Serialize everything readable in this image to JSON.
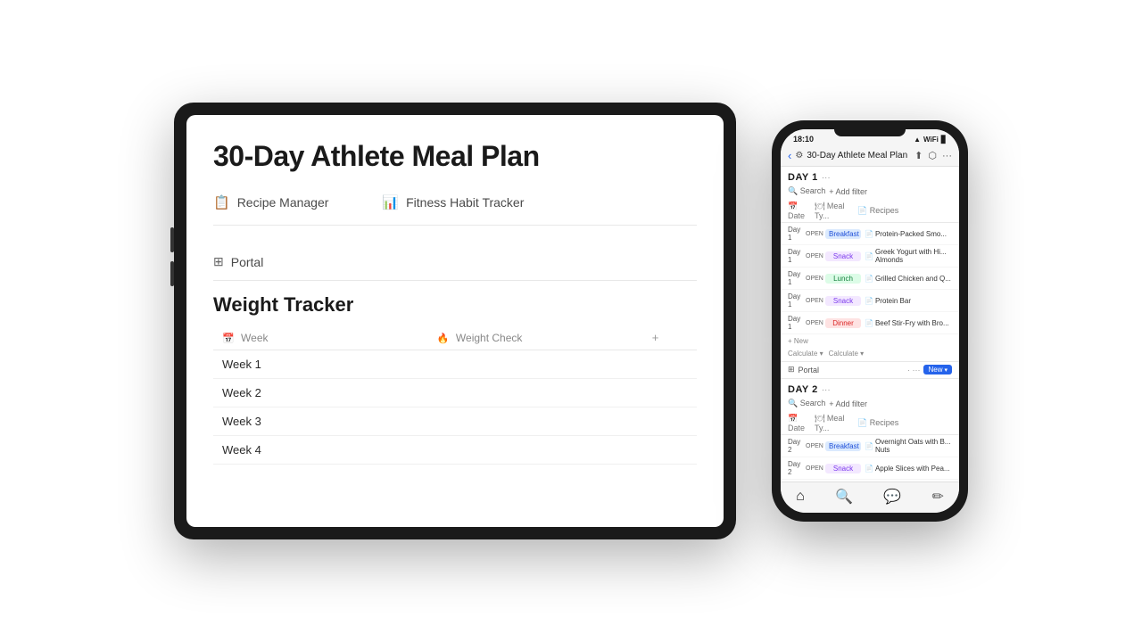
{
  "tablet": {
    "title": "30-Day Athlete Meal Plan",
    "links": [
      {
        "icon": "📋",
        "label": "Recipe Manager"
      },
      {
        "icon": "📊",
        "label": "Fitness Habit Tracker"
      }
    ],
    "portal": {
      "icon": "⊞",
      "label": "Portal"
    },
    "weightTracker": {
      "title": "Weight Tracker",
      "columns": [
        {
          "icon": "📅",
          "label": "Week"
        },
        {
          "icon": "🔥",
          "label": "Weight Check"
        }
      ],
      "rows": [
        {
          "week": "Week 1",
          "weight": ""
        },
        {
          "week": "Week 2",
          "weight": ""
        },
        {
          "week": "Week 3",
          "weight": ""
        },
        {
          "week": "Week 4",
          "weight": ""
        }
      ]
    }
  },
  "phone": {
    "statusBar": {
      "time": "18:10",
      "signal": "▲",
      "wifi": "WiFi",
      "battery": "🔋"
    },
    "topBar": {
      "backIcon": "‹",
      "pageIcon": "⚙",
      "pageTitle": "30-Day Athlete Meal Plan",
      "actions": [
        "⬆",
        "⬡",
        "···"
      ]
    },
    "days": [
      {
        "label": "DAY 1",
        "meals": [
          {
            "day": "Day 1",
            "status": "OPEN",
            "type": "Breakfast",
            "badgeClass": "badge-breakfast",
            "recipe": "Protein-Packed Smo..."
          },
          {
            "day": "Day 1",
            "status": "OPEN",
            "type": "Snack",
            "badgeClass": "badge-snack",
            "recipe": "Greek Yogurt with Hi... Almonds"
          },
          {
            "day": "Day 1",
            "status": "OPEN",
            "type": "Lunch",
            "badgeClass": "badge-lunch",
            "recipe": "Grilled Chicken and Q..."
          },
          {
            "day": "Day 1",
            "status": "OPEN",
            "type": "Snack",
            "badgeClass": "badge-snack",
            "recipe": "Protein Bar"
          },
          {
            "day": "Day 1",
            "status": "OPEN",
            "type": "Dinner",
            "badgeClass": "badge-dinner",
            "recipe": "Beef Stir-Fry with Bro..."
          }
        ]
      },
      {
        "label": "DAY 2",
        "meals": [
          {
            "day": "Day 2",
            "status": "OPEN",
            "type": "Breakfast",
            "badgeClass": "badge-breakfast",
            "recipe": "Overnight Oats with B... Nuts"
          },
          {
            "day": "Day 2",
            "status": "OPEN",
            "type": "Snack",
            "badgeClass": "badge-snack",
            "recipe": "Apple Slices with Pea..."
          }
        ]
      }
    ],
    "portal": {
      "icon": "⊞",
      "label": "Portal"
    },
    "nav": [
      "⌂",
      "🔍",
      "💬",
      "✏️"
    ]
  }
}
